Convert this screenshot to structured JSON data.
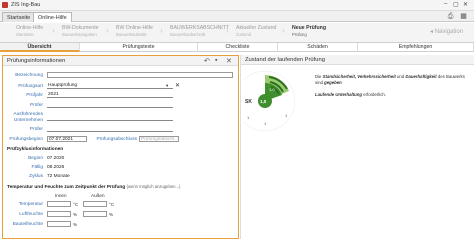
{
  "window": {
    "title": "ZIS Ing-Bau"
  },
  "tabs": [
    {
      "label": "Startseite"
    },
    {
      "label": "Online-Hilfe"
    }
  ],
  "workflow": {
    "steps": [
      {
        "title": "Online-Hilfe",
        "sub": "Startseite"
      },
      {
        "title": "BW-Dokumente",
        "sub": "Bauwerksangaben"
      },
      {
        "title": "BW Online-Hilfe",
        "sub": "Bauwerksdetails"
      },
      {
        "title": "BAUWERKSABSCHNITT",
        "sub": "Bauwerksabschnitt"
      },
      {
        "title": "Aktueller Zustand",
        "sub": "Zustand"
      },
      {
        "title": "Neue Prüfung",
        "sub": "Prüfung"
      }
    ],
    "nav_label": "Navigation"
  },
  "subtabs": [
    "Übersicht",
    "Prüfungstexte",
    "Checkliste",
    "Schäden",
    "Empfehlungen"
  ],
  "pruefung": {
    "title": "Prüfungsinformationen",
    "labels": {
      "bezeichnung": "Bezeichnung",
      "pruefungsart": "Prüfungsart",
      "pruefjahr": "Prüfjahr",
      "pruefer": "Prüfer",
      "ausfuehrende": "Ausführendes Unternehmen",
      "pruefer2": "Prüfer",
      "pruefungsbeginn": "Prüfungsbeginn",
      "pruefungsabschluss": "Prüfungsabschluss"
    },
    "values": {
      "bezeichnung": "",
      "pruefungsart": "Hauptprüfung",
      "pruefjahr": "2021",
      "pruefungsbeginn": "07.07.2021"
    },
    "placeholders": {
      "pruefungsabschluss": "Prüfungsabschl..."
    },
    "zyklus": {
      "title": "Prüfzyklusinformationen",
      "beginn_label": "Beginn",
      "beginn": "07.2020",
      "faellig_label": "Fällig",
      "faellig": "08.2026",
      "zyklus_label": "Zyklus",
      "zyklus": "72 Monate"
    },
    "klima": {
      "title": "Temperatur und Feuchte zum Zeitpunkt der Prüfung",
      "note": "(wenn möglich anzugeben...)",
      "innen": "Innen",
      "aussen": "Außen",
      "rows": [
        {
          "label": "Temperatur",
          "unit": "°C"
        },
        {
          "label": "Luftfeuchte",
          "unit": "%"
        },
        {
          "label": "Bauteilfeuchte",
          "unit": "%"
        }
      ]
    }
  },
  "zustand": {
    "title": "Zustand der laufenden Prüfung",
    "gauge": {
      "sk_label": "SK",
      "sk": "1,0",
      "inner": "1,0",
      "ticks": [
        "1",
        "1",
        "1"
      ]
    },
    "text1_pre": "Die ",
    "text1_bold": "Standsicherheit, Verkehrssicherheit",
    "text1_mid": " und ",
    "text1_bold2": "Dauerhaftigkeit",
    "text1_post": " des Bauwerks sind ",
    "text1_bold3": "gegeben",
    "text2_italic": "Laufende Unterhaltung",
    "text2_post": " erforderlich."
  },
  "colors": {
    "accent": "#e8a03c",
    "gauge_green": "#3f8f2e",
    "gauge_light": "#9acc70",
    "label_blue": "#3a6fb0"
  }
}
